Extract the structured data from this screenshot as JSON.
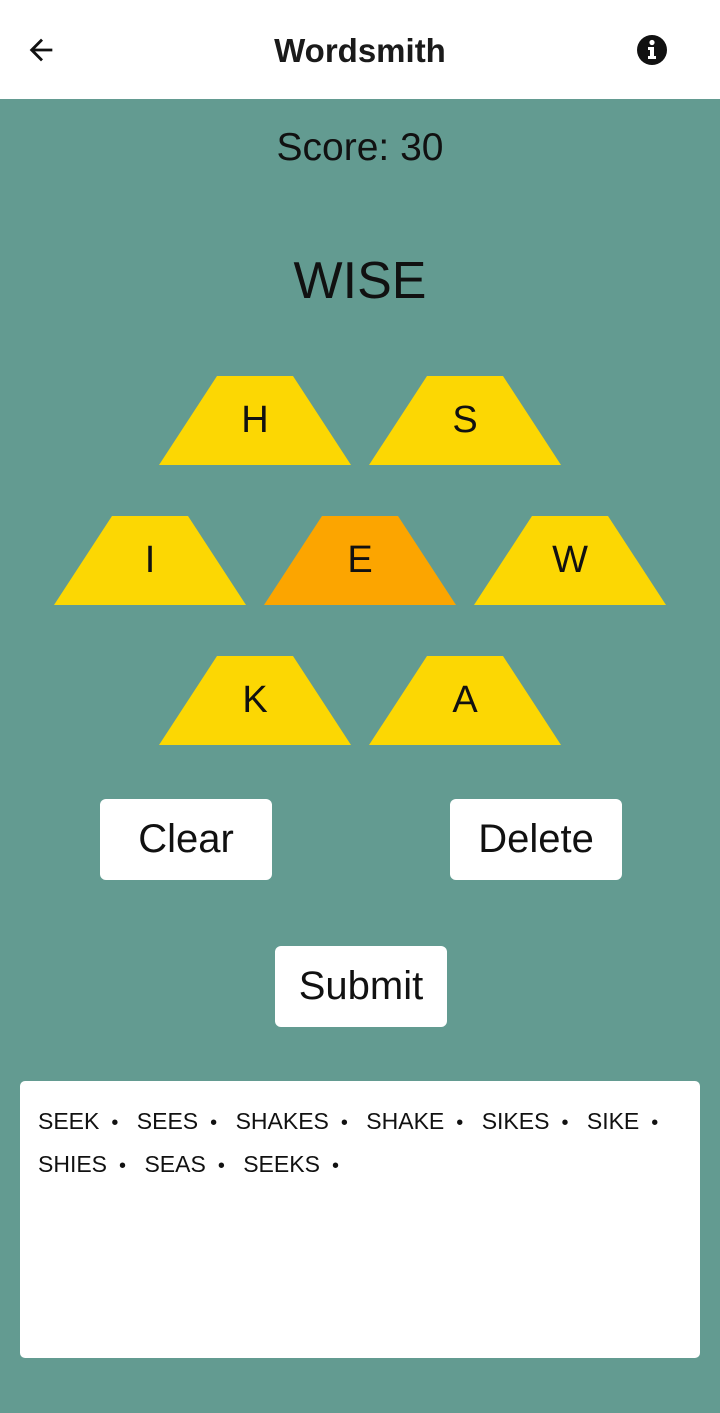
{
  "app": {
    "title": "Wordsmith"
  },
  "game": {
    "score_text": "Score: 30",
    "current_word": "WISE",
    "tiles": [
      {
        "letter": "H",
        "state": "available"
      },
      {
        "letter": "S",
        "state": "available"
      },
      {
        "letter": "I",
        "state": "available"
      },
      {
        "letter": "E",
        "state": "center"
      },
      {
        "letter": "W",
        "state": "available"
      },
      {
        "letter": "K",
        "state": "available"
      },
      {
        "letter": "A",
        "state": "available"
      }
    ],
    "found_words": [
      "SEEK",
      "SEES",
      "SHAKES",
      "SHAKE",
      "SIKES",
      "SIKE",
      "SHIES",
      "SEAS",
      "SEEKS"
    ],
    "separator": "•"
  },
  "controls": {
    "clear_label": "Clear",
    "delete_label": "Delete",
    "submit_label": "Submit"
  },
  "colors": {
    "background": "#639b91",
    "tile": "#fcd703",
    "tile_center": "#fca500",
    "button": "#ffffff"
  },
  "icons": {
    "back": "arrow-left-icon",
    "info": "info-circle-icon"
  }
}
